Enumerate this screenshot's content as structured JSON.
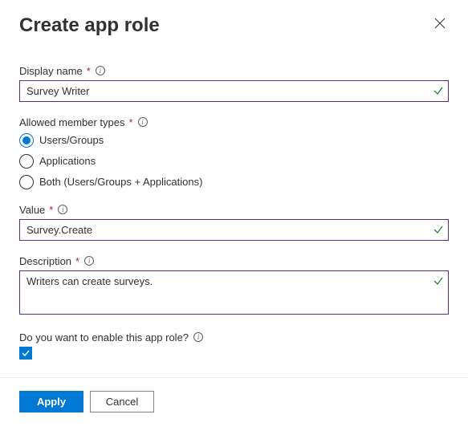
{
  "header": {
    "title": "Create app role"
  },
  "fields": {
    "displayName": {
      "label": "Display name",
      "required": "*",
      "value": "Survey Writer"
    },
    "memberTypes": {
      "label": "Allowed member types",
      "required": "*",
      "options": [
        {
          "label": "Users/Groups",
          "selected": true
        },
        {
          "label": "Applications",
          "selected": false
        },
        {
          "label": "Both (Users/Groups + Applications)",
          "selected": false
        }
      ]
    },
    "value": {
      "label": "Value",
      "required": "*",
      "value": "Survey.Create"
    },
    "description": {
      "label": "Description",
      "required": "*",
      "value": "Writers can create surveys."
    },
    "enable": {
      "label": "Do you want to enable this app role?",
      "checked": true
    }
  },
  "footer": {
    "apply": "Apply",
    "cancel": "Cancel"
  }
}
